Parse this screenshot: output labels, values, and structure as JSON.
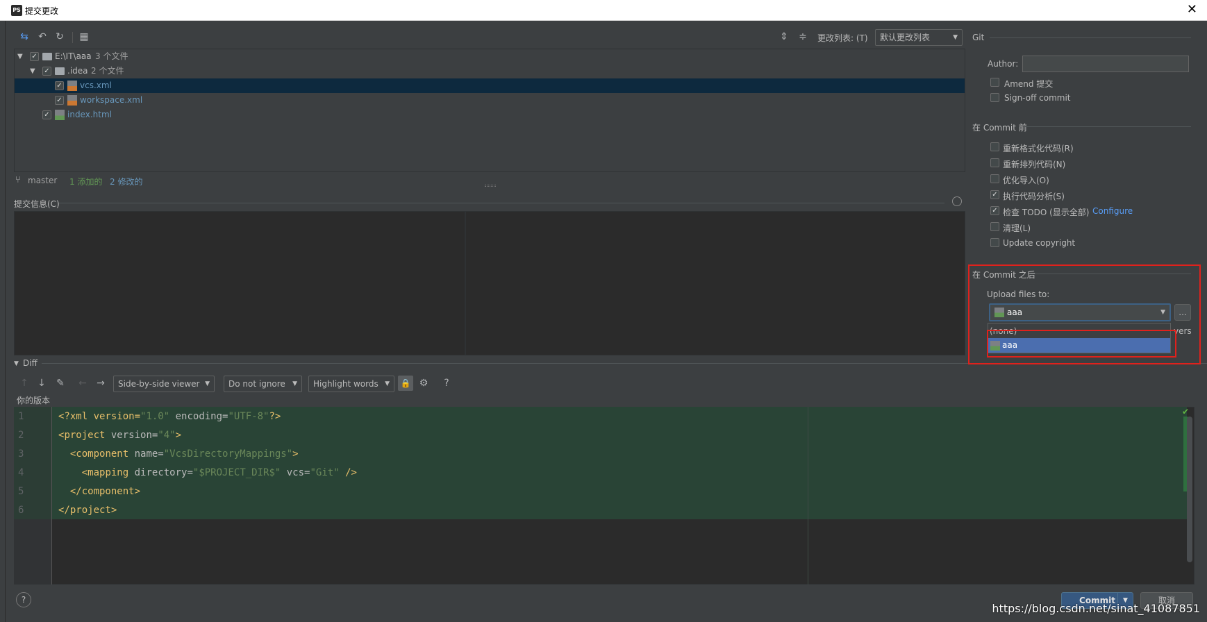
{
  "window": {
    "app_badge": "PS",
    "title": "提交更改",
    "close": "✕"
  },
  "toolbar": {
    "changelist_label": "更改列表: (T)",
    "changelist_value": "默认更改列表"
  },
  "tree": {
    "rows": [
      {
        "name": "E:\\IT\\aaa",
        "count": "3 个文件"
      },
      {
        "name": ".idea",
        "count": "2 个文件"
      },
      {
        "name": "vcs.xml"
      },
      {
        "name": "workspace.xml"
      },
      {
        "name": "index.html"
      }
    ]
  },
  "status": {
    "branch": "master",
    "added": "1 添加的",
    "modified": "2 修改的"
  },
  "commit_message": {
    "label": "提交信息(C)"
  },
  "diff": {
    "label": "Diff",
    "viewer": "Side-by-side viewer",
    "ignore": "Do not ignore",
    "highlight": "Highlight words",
    "help": "?",
    "your_version": "你的版本",
    "line_numbers": [
      "1",
      "2",
      "3",
      "4",
      "5",
      "6"
    ],
    "code": {
      "l1": {
        "a": "<?xml version=",
        "b": "\"1.0\"",
        "c": " encoding=",
        "d": "\"UTF-8\"",
        "e": "?>"
      },
      "l2": {
        "a": "<",
        "b": "project",
        "c": " version=",
        "d": "\"4\"",
        "e": ">"
      },
      "l3": {
        "a": "  <",
        "b": "component",
        "c": " name=",
        "d": "\"VcsDirectoryMappings\"",
        "e": ">"
      },
      "l4": {
        "a": "    <",
        "b": "mapping",
        "c": " directory=",
        "d": "\"$PROJECT_DIR$\"",
        "e": " vcs=",
        "f": "\"Git\"",
        "g": " />"
      },
      "l5": {
        "a": "  </",
        "b": "component",
        "c": ">"
      },
      "l6": {
        "a": "</",
        "b": "project",
        "c": ">"
      }
    }
  },
  "right_panel": {
    "git_label": "Git",
    "author_label": "Author:",
    "amend": "Amend 提交",
    "signoff": "Sign-off commit",
    "before_commit": "在 Commit 前",
    "reformat": "重新格式化代码(R)",
    "rearrange": "重新排列代码(N)",
    "optimize_imports": "优化导入(O)",
    "code_analysis": "执行代码分析(S)",
    "check_todo": "检查 TODO (显示全部)",
    "configure": "Configure",
    "cleanup": "清理(L)",
    "update_copyright": "Update copyright",
    "after_commit": "在 Commit 之后",
    "upload_label": "Upload files to:",
    "upload_value": "aaa",
    "upload_more": "...",
    "dropdown_options": [
      "(none)",
      "aaa"
    ],
    "cut_text": "vers"
  },
  "footer": {
    "help": "?",
    "commit": "Commit",
    "cancel": "取消",
    "watermark": "https://blog.csdn.net/sinat_41087851"
  },
  "colors": {
    "selection": "#0d293e",
    "added_bg": "#294436",
    "accent_red": "#e0211c",
    "dropdown_selected": "#4b6eaf"
  }
}
